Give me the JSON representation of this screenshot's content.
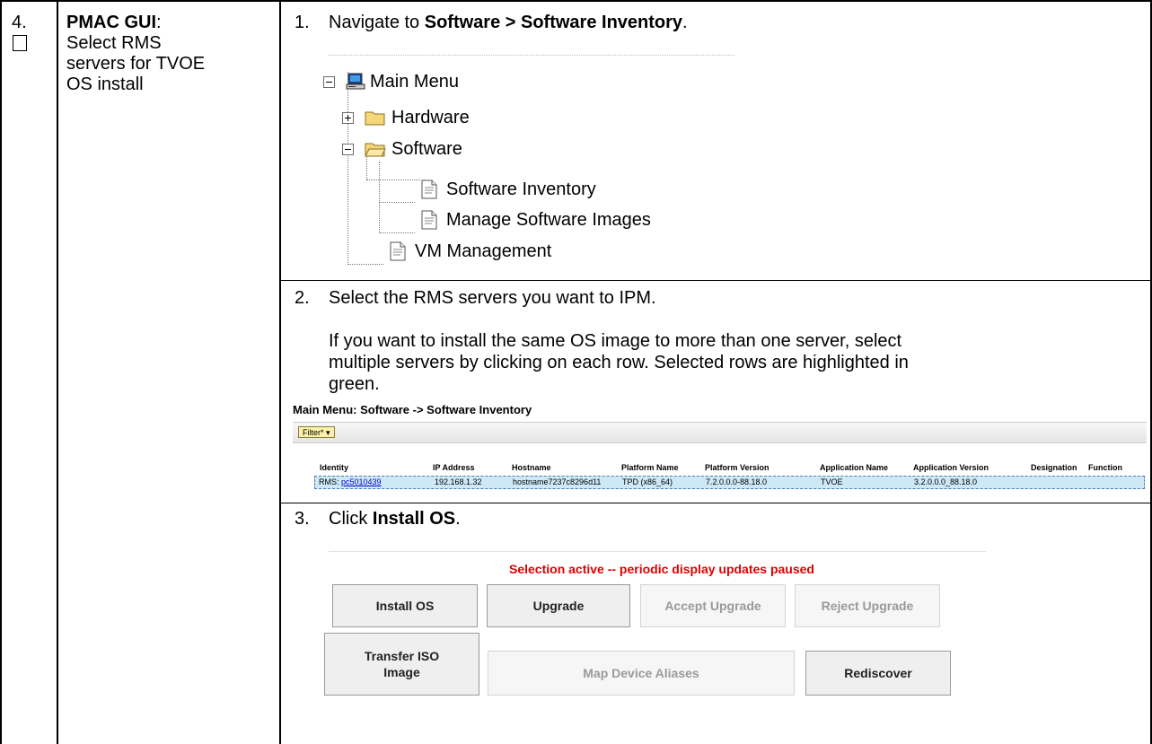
{
  "step": {
    "number": "4.",
    "checkbox": "",
    "title_bold": "PMAC GUI",
    "title_colon": ":",
    "desc_lines": [
      "Select RMS",
      "servers for TVOE",
      "OS install"
    ]
  },
  "instructions": {
    "s1": {
      "num": "1.",
      "pre": "Navigate to ",
      "bold": "Software > Software Inventory",
      "post": "."
    },
    "s2": {
      "num": "2.",
      "text": "Select the RMS servers you want to IPM.",
      "para_lines": [
        "If you want to install the same OS image to more than one server, select",
        "multiple servers by clicking on each row.  Selected rows are highlighted in",
        "green."
      ]
    },
    "s3": {
      "num": "3.",
      "pre": "Click ",
      "bold": "Install OS",
      "post": "."
    }
  },
  "tree": {
    "root": {
      "label": "Main Menu",
      "icon": "computer-icon",
      "state": "collapse"
    },
    "hardware": {
      "label": "Hardware",
      "icon": "folder-closed-icon",
      "state": "expand"
    },
    "software": {
      "label": "Software",
      "icon": "folder-open-icon",
      "state": "collapse"
    },
    "software_inventory": {
      "label": "Software Inventory",
      "icon": "document-icon"
    },
    "manage_images": {
      "label": "Manage Software Images",
      "icon": "document-icon"
    },
    "vm_management": {
      "label": "VM Management",
      "icon": "document-icon"
    }
  },
  "inventory": {
    "title": "Main Menu: Software -> Software Inventory",
    "filter_label": "Filter*",
    "columns": [
      "Identity",
      "IP Address",
      "Hostname",
      "Platform Name",
      "Platform Version",
      "Application Name",
      "Application Version",
      "Designation",
      "Function"
    ],
    "row": {
      "identity_prefix": "RMS: ",
      "identity_link": "pc5010439",
      "ip": "192.168.1.32",
      "hostname": "hostname7237c8296d11",
      "platform_name": "TPD (x86_64)",
      "platform_version": "7.2.0.0.0-88.18.0",
      "app_name": "TVOE",
      "app_version": "3.2.0.0.0_88.18.0",
      "designation": "",
      "function": ""
    },
    "row_highlight_color": "#c9e9f7"
  },
  "actions": {
    "notice": "Selection active -- periodic display updates paused",
    "notice_color": "#e00000",
    "buttons": {
      "install_os": "Install OS",
      "upgrade": "Upgrade",
      "accept_upgrade": "Accept Upgrade",
      "reject_upgrade": "Reject Upgrade",
      "transfer_iso_line1": "Transfer ISO",
      "transfer_iso_line2": "Image",
      "map_device_aliases": "Map Device Aliases",
      "rediscover": "Rediscover"
    }
  }
}
